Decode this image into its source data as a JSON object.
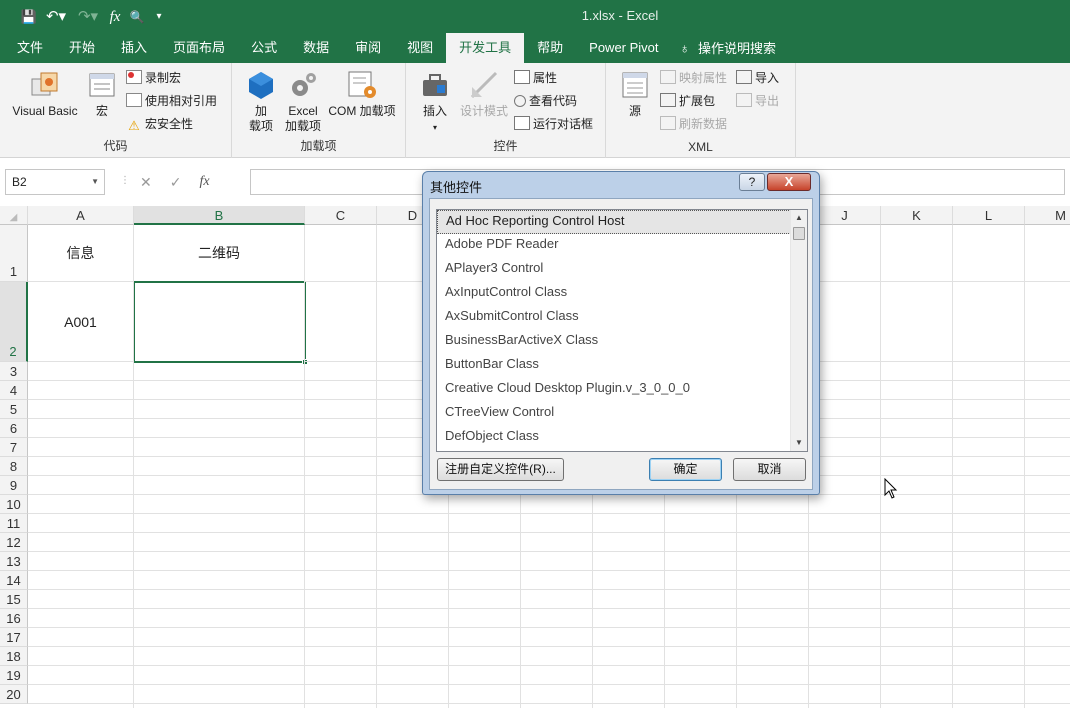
{
  "titlebar": {
    "title": "1.xlsx  -  Excel",
    "qat": {
      "save_icon": "💾",
      "undo_icon": "↶▾",
      "redo_icon": "↷▾",
      "fx_icon": "fx",
      "preview_icon": "🔍",
      "customize_icon": "▾"
    }
  },
  "tabs": [
    "文件",
    "开始",
    "插入",
    "页面布局",
    "公式",
    "数据",
    "审阅",
    "视图",
    "开发工具",
    "帮助",
    "Power Pivot",
    "操作说明搜索"
  ],
  "active_tab": "开发工具",
  "ribbon": {
    "code": {
      "label": "代码",
      "visual_basic": "Visual Basic",
      "macros": "宏",
      "record_macro": "录制宏",
      "use_relative": "使用相对引用",
      "macro_security": "宏安全性"
    },
    "addins": {
      "label": "加载项",
      "addins_line1": "加",
      "addins_line2": "载项",
      "excel_addins_line1": "Excel",
      "excel_addins_line2": "加载项",
      "com_addins": "COM 加载项"
    },
    "controls": {
      "label": "控件",
      "insert": "插入",
      "design_mode": "设计模式",
      "properties": "属性",
      "view_code": "查看代码",
      "run_dialog": "运行对话框"
    },
    "xml": {
      "label": "XML",
      "source": "源",
      "map_properties": "映射属性",
      "expansion_packs": "扩展包",
      "refresh_data": "刷新数据",
      "import": "导入",
      "export": "导出"
    }
  },
  "formula_bar": {
    "name_box": "B2",
    "cancel_icon": "✕",
    "enter_icon": "✓",
    "fx_label": "fx",
    "formula": ""
  },
  "sheet": {
    "columns": [
      "A",
      "B",
      "C",
      "D",
      "",
      "",
      "",
      "",
      "",
      "J",
      "K",
      "L",
      "M"
    ],
    "rows": [
      "1",
      "2",
      "3",
      "4",
      "5",
      "6",
      "7",
      "8",
      "9",
      "10",
      "11",
      "12",
      "13",
      "14",
      "15",
      "16",
      "17",
      "18",
      "19",
      "20"
    ],
    "cells": {
      "A1": "信息",
      "B1": "二维码",
      "A2": "A001",
      "B2": ""
    },
    "selected_cell": "B2"
  },
  "dialog": {
    "title": "其他控件",
    "help_label": "?",
    "close_label": "X",
    "items": [
      "Ad Hoc Reporting Control Host",
      "Adobe PDF Reader",
      "APlayer3 Control",
      "AxInputControl Class",
      "AxSubmitControl Class",
      "BusinessBarActiveX Class",
      "ButtonBar Class",
      "Creative Cloud Desktop Plugin.v_3_0_0_0",
      "CTreeView Control",
      "DefObject Class"
    ],
    "register_button": "注册自定义控件(R)...",
    "ok_button": "确定",
    "cancel_button": "取消"
  },
  "colors": {
    "excel_green": "#217346",
    "ribbon_bg": "#f3f3f3",
    "dialog_frame": "#bcd0e8"
  }
}
